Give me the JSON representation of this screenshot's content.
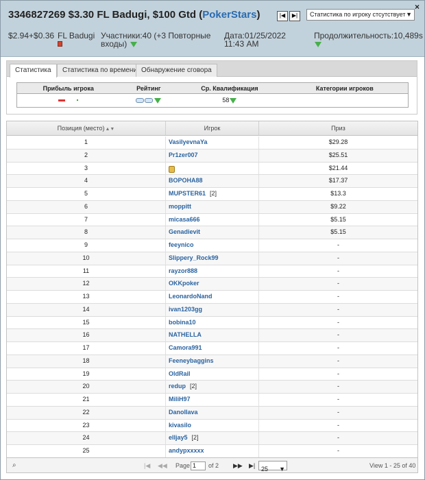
{
  "header": {
    "tournament_id": "3346827269",
    "title_text": "$3.30 FL Badugi, $100 Gtd (",
    "room": "PokerStars",
    "title_close": ")",
    "stats_select": "Статистика по игроку стсутствует",
    "close": "×",
    "buyin": "$2.94+$0.36",
    "game": "FL Badugi",
    "players": "Участники:40 (+3 Повторные входы)",
    "date": "Дата:01/25/2022 11:43 AM",
    "duration": "Продолжительность:10,489s"
  },
  "tabs": [
    {
      "label": "Статистика",
      "active": true
    },
    {
      "label": "Статистика по времени",
      "active": false
    },
    {
      "label": "Обнаружение сговора",
      "active": false
    }
  ],
  "stats": {
    "headers": [
      "Прибыль игрока",
      "Рейтинг",
      "Ср. Квалификация",
      "Категории игроков"
    ],
    "avg_qualification": "58"
  },
  "grid": {
    "headers": [
      "Позиция (место)",
      "Игрок",
      "Приз"
    ],
    "rows": [
      {
        "pos": "1",
        "player": "VasilyevnaYa",
        "reentry": "",
        "prize": "$29.28"
      },
      {
        "pos": "2",
        "player": "Pr1zer007",
        "reentry": "",
        "prize": "$25.51"
      },
      {
        "pos": "3",
        "player": "",
        "reentry": "",
        "prize": "$21.44",
        "locked": true
      },
      {
        "pos": "4",
        "player": "BOPOHA88",
        "reentry": "",
        "prize": "$17.37"
      },
      {
        "pos": "5",
        "player": "MUPSTER61",
        "reentry": "[2]",
        "prize": "$13.3"
      },
      {
        "pos": "6",
        "player": "moppitt",
        "reentry": "",
        "prize": "$9.22"
      },
      {
        "pos": "7",
        "player": "micasa666",
        "reentry": "",
        "prize": "$5.15"
      },
      {
        "pos": "8",
        "player": "Genadievit",
        "reentry": "",
        "prize": "$5.15"
      },
      {
        "pos": "9",
        "player": "feeynico",
        "reentry": "",
        "prize": "-"
      },
      {
        "pos": "10",
        "player": "Slippery_Rock99",
        "reentry": "",
        "prize": "-"
      },
      {
        "pos": "11",
        "player": "rayzor888",
        "reentry": "",
        "prize": "-"
      },
      {
        "pos": "12",
        "player": "OKKpoker",
        "reentry": "",
        "prize": "-"
      },
      {
        "pos": "13",
        "player": "LeonardoNand",
        "reentry": "",
        "prize": "-"
      },
      {
        "pos": "14",
        "player": "ivan1203gg",
        "reentry": "",
        "prize": "-"
      },
      {
        "pos": "15",
        "player": "bobina10",
        "reentry": "",
        "prize": "-"
      },
      {
        "pos": "16",
        "player": "NATHELLA",
        "reentry": "",
        "prize": "-"
      },
      {
        "pos": "17",
        "player": "Camora991",
        "reentry": "",
        "prize": "-"
      },
      {
        "pos": "18",
        "player": "Feeneybaggins",
        "reentry": "",
        "prize": "-"
      },
      {
        "pos": "19",
        "player": "OldRail",
        "reentry": "",
        "prize": "-"
      },
      {
        "pos": "20",
        "player": "redup",
        "reentry": "[2]",
        "prize": "-"
      },
      {
        "pos": "21",
        "player": "MiliH97",
        "reentry": "",
        "prize": "-"
      },
      {
        "pos": "22",
        "player": "DanoIIava",
        "reentry": "",
        "prize": "-"
      },
      {
        "pos": "23",
        "player": "kivasilo",
        "reentry": "",
        "prize": "-"
      },
      {
        "pos": "24",
        "player": "elljay5",
        "reentry": "[2]",
        "prize": "-"
      },
      {
        "pos": "25",
        "player": "andypxxxxx",
        "reentry": "",
        "prize": "-"
      }
    ]
  },
  "pager": {
    "page_label": "Page",
    "page_value": "1",
    "of_label": "of 2",
    "page_size": "25",
    "view_text": "View 1 - 25 of 40"
  },
  "colors": {
    "header_bg": "#c2d2dc",
    "link_blue": "#2a63a0",
    "down_triangle": "#46b04a"
  }
}
